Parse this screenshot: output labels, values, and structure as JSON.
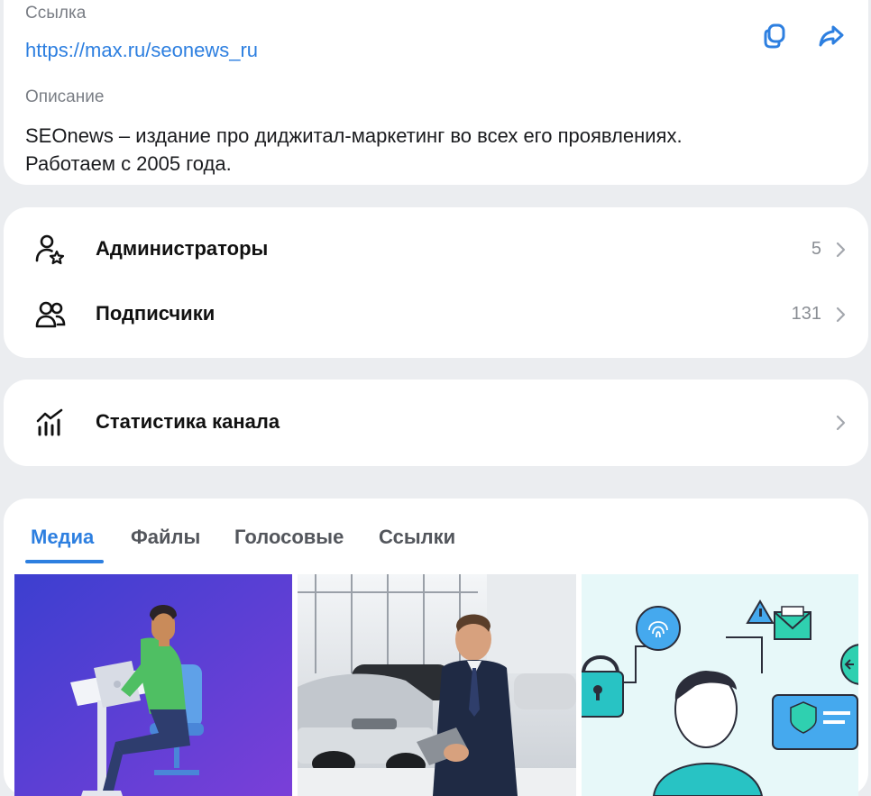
{
  "info": {
    "link_label": "Ссылка",
    "link_url": "https://max.ru/seonews_ru",
    "description_label": "Описание",
    "description_line1": "SEOnews – издание про диджитал-маркетинг во всех его проявлениях.",
    "description_line2": "Работаем с 2005 года.",
    "copy_icon": "copy-icon",
    "share_icon": "share-icon"
  },
  "members": [
    {
      "label": "Администраторы",
      "count": "5",
      "icon": "admin-star-icon"
    },
    {
      "label": "Подписчики",
      "count": "131",
      "icon": "subscribers-icon"
    }
  ],
  "stats": {
    "label": "Статистика канала",
    "icon": "stats-chart-icon"
  },
  "tabs": [
    {
      "label": "Медиа",
      "active": true
    },
    {
      "label": "Файлы",
      "active": false
    },
    {
      "label": "Голосовые",
      "active": false
    },
    {
      "label": "Ссылки",
      "active": false
    }
  ],
  "media": [
    {
      "name": "illustration of man at laptop"
    },
    {
      "name": "photo of businessman in car showroom"
    },
    {
      "name": "illustration of cybersecurity"
    }
  ],
  "colors": {
    "accent": "#2d7fe0",
    "background": "#ebedf0",
    "card": "#ffffff"
  }
}
